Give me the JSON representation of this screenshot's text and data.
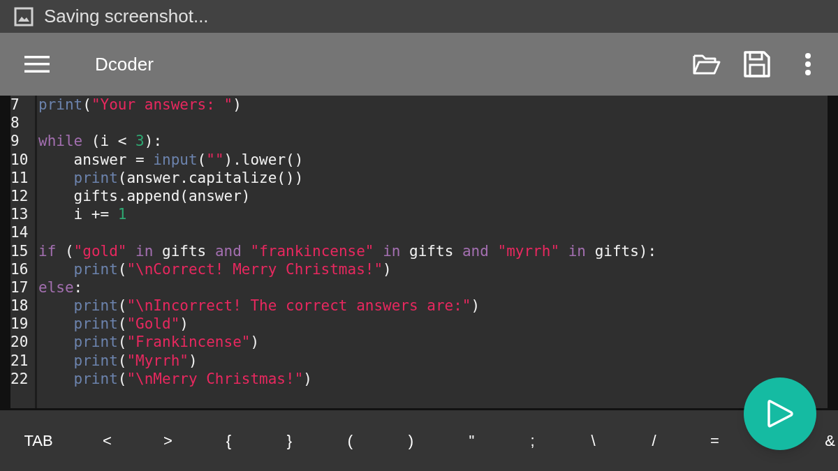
{
  "status_bar": {
    "notification": "Saving screenshot..."
  },
  "toolbar": {
    "title": "Dcoder"
  },
  "editor": {
    "lines": [
      {
        "number": "7",
        "indented": false,
        "tokens": [
          {
            "kind": "builtin",
            "text": "print"
          },
          {
            "kind": "plain",
            "text": "("
          },
          {
            "kind": "string",
            "text": "\"Your answers: \""
          },
          {
            "kind": "plain",
            "text": ")"
          }
        ]
      },
      {
        "number": "8"
      },
      {
        "number": "9",
        "indented": false,
        "tokens": [
          {
            "kind": "keyword",
            "text": "while"
          },
          {
            "kind": "plain",
            "text": " (i < "
          },
          {
            "kind": "number",
            "text": "3"
          },
          {
            "kind": "plain",
            "text": "):"
          }
        ]
      },
      {
        "number": "10",
        "indented": true,
        "tokens": [
          {
            "kind": "plain",
            "text": "answer = "
          },
          {
            "kind": "builtin",
            "text": "input"
          },
          {
            "kind": "plain",
            "text": "("
          },
          {
            "kind": "string",
            "text": "\"\""
          },
          {
            "kind": "plain",
            "text": ").lower()"
          }
        ]
      },
      {
        "number": "11",
        "indented": true,
        "tokens": [
          {
            "kind": "builtin",
            "text": "print"
          },
          {
            "kind": "plain",
            "text": "(answer.capitalize())"
          }
        ]
      },
      {
        "number": "12",
        "indented": true,
        "tokens": [
          {
            "kind": "plain",
            "text": "gifts.append(answer)"
          }
        ]
      },
      {
        "number": "13",
        "indented": true,
        "tokens": [
          {
            "kind": "plain",
            "text": "i += "
          },
          {
            "kind": "number",
            "text": "1"
          }
        ]
      },
      {
        "number": "14"
      },
      {
        "number": "15",
        "indented": false,
        "tokens": [
          {
            "kind": "keyword",
            "text": "if"
          },
          {
            "kind": "plain",
            "text": " ("
          },
          {
            "kind": "string",
            "text": "\"gold\""
          },
          {
            "kind": "keyword",
            "text": " in"
          },
          {
            "kind": "plain",
            "text": " gifts "
          },
          {
            "kind": "keyword",
            "text": "and"
          },
          {
            "kind": "string",
            "text": " \"frankincense\""
          },
          {
            "kind": "keyword",
            "text": " in"
          },
          {
            "kind": "plain",
            "text": " gifts "
          },
          {
            "kind": "keyword",
            "text": "and"
          },
          {
            "kind": "string",
            "text": " \"myrrh\""
          },
          {
            "kind": "keyword",
            "text": " in"
          },
          {
            "kind": "plain",
            "text": " gifts):"
          }
        ]
      },
      {
        "number": "16",
        "indented": true,
        "tokens": [
          {
            "kind": "builtin",
            "text": "print"
          },
          {
            "kind": "plain",
            "text": "("
          },
          {
            "kind": "string",
            "text": "\"\\nCorrect! Merry Christmas!\""
          },
          {
            "kind": "plain",
            "text": ")"
          }
        ]
      },
      {
        "number": "17",
        "indented": false,
        "tokens": [
          {
            "kind": "keyword",
            "text": "else"
          },
          {
            "kind": "plain",
            "text": ":"
          }
        ]
      },
      {
        "number": "18",
        "indented": true,
        "tokens": [
          {
            "kind": "builtin",
            "text": "print"
          },
          {
            "kind": "plain",
            "text": "("
          },
          {
            "kind": "string",
            "text": "\"\\nIncorrect! The correct answers are:\""
          },
          {
            "kind": "plain",
            "text": ")"
          }
        ]
      },
      {
        "number": "19",
        "indented": true,
        "tokens": [
          {
            "kind": "builtin",
            "text": "print"
          },
          {
            "kind": "plain",
            "text": "("
          },
          {
            "kind": "string",
            "text": "\"Gold\""
          },
          {
            "kind": "plain",
            "text": ")"
          }
        ]
      },
      {
        "number": "20",
        "indented": true,
        "tokens": [
          {
            "kind": "builtin",
            "text": "print"
          },
          {
            "kind": "plain",
            "text": "("
          },
          {
            "kind": "string",
            "text": "\"Frankincense\""
          },
          {
            "kind": "plain",
            "text": ")"
          }
        ]
      },
      {
        "number": "21",
        "indented": true,
        "tokens": [
          {
            "kind": "builtin",
            "text": "print"
          },
          {
            "kind": "plain",
            "text": "("
          },
          {
            "kind": "string",
            "text": "\"Myrrh\""
          },
          {
            "kind": "plain",
            "text": ")"
          }
        ]
      },
      {
        "number": "22",
        "indented": true,
        "tokens": [
          {
            "kind": "builtin",
            "text": "print"
          },
          {
            "kind": "plain",
            "text": "("
          },
          {
            "kind": "string",
            "text": "\"\\nMerry Christmas!\""
          },
          {
            "kind": "plain",
            "text": ")"
          }
        ]
      }
    ]
  },
  "keys": [
    "TAB",
    "<",
    ">",
    "{",
    "}",
    "(",
    ")",
    "\"",
    ";",
    "\\",
    "/",
    "=",
    "&"
  ]
}
